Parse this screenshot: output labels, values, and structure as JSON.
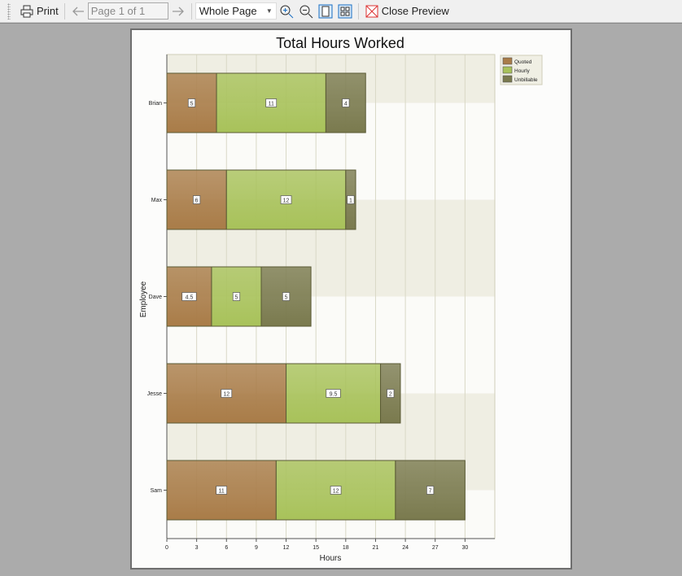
{
  "toolbar": {
    "print_label": "Print",
    "page_indicator": "Page 1 of 1",
    "zoom_mode": "Whole Page",
    "close_label": "Close Preview"
  },
  "chart_data": {
    "type": "bar",
    "orientation": "horizontal",
    "stacked": true,
    "title": "Total Hours Worked",
    "xlabel": "Hours",
    "ylabel": "Employee",
    "categories": [
      "Brian",
      "Max",
      "Dave",
      "Jesse",
      "Sam"
    ],
    "series": [
      {
        "name": "Quoted",
        "color": "#a97c48",
        "values": [
          5,
          6,
          4.5,
          12,
          11
        ]
      },
      {
        "name": "Hourly",
        "color": "#a8c25a",
        "values": [
          11,
          12,
          5,
          9.5,
          12
        ]
      },
      {
        "name": "Unbillable",
        "color": "#7a7a4e",
        "values": [
          4,
          1,
          5,
          2,
          7
        ]
      }
    ],
    "xlim": [
      0,
      33
    ],
    "xticks": [
      0,
      3,
      6,
      9,
      12,
      15,
      18,
      21,
      24,
      27,
      30
    ],
    "grid": true,
    "legend": "top-right",
    "data_labels": true
  }
}
